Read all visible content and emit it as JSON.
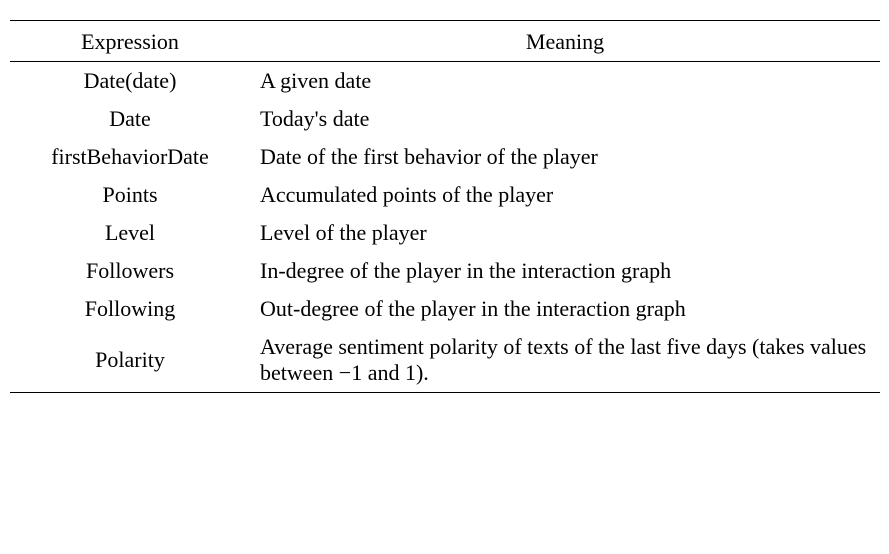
{
  "headers": {
    "expression": "Expression",
    "meaning": "Meaning"
  },
  "rows": [
    {
      "expression": "Date(date)",
      "meaning": "A given date"
    },
    {
      "expression": "Date",
      "meaning": "Today's date"
    },
    {
      "expression": "firstBehaviorDate",
      "meaning": "Date of the first behavior of the player"
    },
    {
      "expression": "Points",
      "meaning": "Accumulated points of the player"
    },
    {
      "expression": "Level",
      "meaning": "Level of the player"
    },
    {
      "expression": "Followers",
      "meaning": "In-degree of the player in the interaction graph"
    },
    {
      "expression": "Following",
      "meaning": "Out-degree of the player in the interaction graph"
    },
    {
      "expression": "Polarity",
      "meaning": "Average sentiment polarity of texts of the last five days (takes values between −1 and 1)."
    }
  ]
}
